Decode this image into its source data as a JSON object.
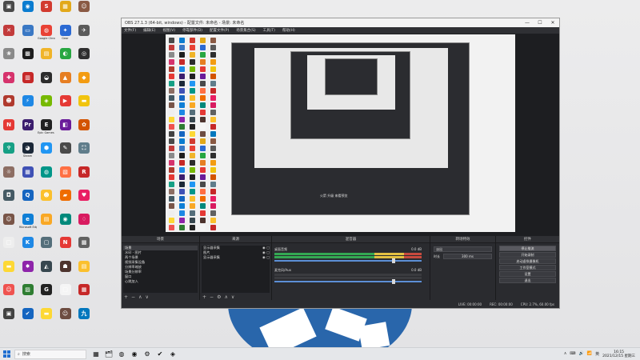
{
  "desktop": {
    "icons": [
      {
        "label": "",
        "color": "#4a4a4a",
        "glyph": "▣"
      },
      {
        "label": "",
        "color": "#0a7cd0",
        "glyph": "◉"
      },
      {
        "label": "",
        "color": "#d23b2f",
        "glyph": "S"
      },
      {
        "label": "",
        "color": "#e2a81a",
        "glyph": "▦"
      },
      {
        "label": "",
        "color": "#8a5a44",
        "glyph": "☺"
      },
      {
        "label": "",
        "color": "#c23b3b",
        "glyph": "✕"
      },
      {
        "label": "",
        "color": "#3a78c4",
        "glyph": "▭"
      },
      {
        "label": "Google Chrome",
        "color": "#e94235",
        "glyph": "◍"
      },
      {
        "label": "Gear",
        "color": "#2b6ad3",
        "glyph": "✦"
      },
      {
        "label": "",
        "color": "#5a5a5a",
        "glyph": "✈"
      },
      {
        "label": "",
        "color": "#8a8a8a",
        "glyph": "❀"
      },
      {
        "label": "",
        "color": "#1d1d1d",
        "glyph": "▩"
      },
      {
        "label": "",
        "color": "#f0b429",
        "glyph": "▤"
      },
      {
        "label": "",
        "color": "#27a641",
        "glyph": "◐"
      },
      {
        "label": "",
        "color": "#2f2f2f",
        "glyph": "◎"
      },
      {
        "label": "",
        "color": "#d6336c",
        "glyph": "✚"
      },
      {
        "label": "",
        "color": "#c62828",
        "glyph": "▥"
      },
      {
        "label": "",
        "color": "#2c2c2c",
        "glyph": "◒"
      },
      {
        "label": "",
        "color": "#e67e22",
        "glyph": "▲"
      },
      {
        "label": "",
        "color": "#f39c12",
        "glyph": "◆"
      },
      {
        "label": "",
        "color": "#b03a2e",
        "glyph": "☻"
      },
      {
        "label": "",
        "color": "#1e88e5",
        "glyph": "⚡"
      },
      {
        "label": "",
        "color": "#76b900",
        "glyph": "◈"
      },
      {
        "label": "",
        "color": "#e53935",
        "glyph": "▶"
      },
      {
        "label": "",
        "color": "#f1c40f",
        "glyph": "▬"
      },
      {
        "label": "",
        "color": "#e53935",
        "glyph": "N"
      },
      {
        "label": "",
        "color": "#3c1e6e",
        "glyph": "Pr"
      },
      {
        "label": "Epic Games Launcher",
        "color": "#222",
        "glyph": "E"
      },
      {
        "label": "",
        "color": "#6a1b9a",
        "glyph": "◧"
      },
      {
        "label": "",
        "color": "#d35400",
        "glyph": "✿"
      },
      {
        "label": "",
        "color": "#16a085",
        "glyph": "♆"
      },
      {
        "label": "Steam",
        "color": "#1b2838",
        "glyph": "◕"
      },
      {
        "label": "",
        "color": "#2196f3",
        "glyph": "⬢"
      },
      {
        "label": "",
        "color": "#4a4a4a",
        "glyph": "✎"
      },
      {
        "label": "",
        "color": "#607d8b",
        "glyph": "⛶"
      },
      {
        "label": "",
        "color": "#8d6e63",
        "glyph": "☼"
      },
      {
        "label": "",
        "color": "#3f51b5",
        "glyph": "▦"
      },
      {
        "label": "",
        "color": "#009688",
        "glyph": "◍"
      },
      {
        "label": "",
        "color": "#ff7043",
        "glyph": "▧"
      },
      {
        "label": "",
        "color": "#c62828",
        "glyph": "R"
      },
      {
        "label": "",
        "color": "#455a64",
        "glyph": "◘"
      },
      {
        "label": "",
        "color": "#1565c0",
        "glyph": "Q"
      },
      {
        "label": "",
        "color": "#fbc02d",
        "glyph": "☻"
      },
      {
        "label": "",
        "color": "#ef6c00",
        "glyph": "▰"
      },
      {
        "label": "",
        "color": "#e91e63",
        "glyph": "♥"
      },
      {
        "label": "",
        "color": "#795548",
        "glyph": "☺"
      },
      {
        "label": "Microsoft Edge",
        "color": "#0f7fd6",
        "glyph": "e"
      },
      {
        "label": "",
        "color": "#f9a825",
        "glyph": "▤"
      },
      {
        "label": "",
        "color": "#00897b",
        "glyph": "◉"
      },
      {
        "label": "",
        "color": "#d81b60",
        "glyph": "♢"
      },
      {
        "label": "",
        "color": "#eeeeee",
        "glyph": "□"
      },
      {
        "label": "",
        "color": "#1e88e5",
        "glyph": "K"
      },
      {
        "label": "",
        "color": "#546e7a",
        "glyph": "▢"
      },
      {
        "label": "",
        "color": "#e53935",
        "glyph": "N"
      },
      {
        "label": "",
        "color": "#616161",
        "glyph": "▩"
      },
      {
        "label": "",
        "color": "#fdd835",
        "glyph": "▬"
      },
      {
        "label": "",
        "color": "#8e24aa",
        "glyph": "✸"
      },
      {
        "label": "",
        "color": "#37474f",
        "glyph": "◭"
      },
      {
        "label": "",
        "color": "#4e342e",
        "glyph": "☗"
      },
      {
        "label": "",
        "color": "#fbc02d",
        "glyph": "▤"
      },
      {
        "label": "",
        "color": "#ef5350",
        "glyph": "☺"
      },
      {
        "label": "",
        "color": "#2e7d32",
        "glyph": "▨"
      },
      {
        "label": "",
        "color": "#222",
        "glyph": "G"
      },
      {
        "label": "",
        "color": "#f5f5f5",
        "glyph": "□"
      },
      {
        "label": "",
        "color": "#c62828",
        "glyph": "▦"
      },
      {
        "label": "",
        "color": "#424242",
        "glyph": "▣"
      },
      {
        "label": "",
        "color": "#1565c0",
        "glyph": "✔"
      },
      {
        "label": "",
        "color": "#fdd835",
        "glyph": "▬"
      },
      {
        "label": "",
        "color": "#6d4c41",
        "glyph": "☺"
      },
      {
        "label": "",
        "color": "#0277bd",
        "glyph": "九"
      }
    ]
  },
  "obs": {
    "title": "OBS 27.1.3 (64-bit, windows) - 配置文件: 未命名 - 场景: 未命名",
    "menu": [
      "文件(F)",
      "编辑(E)",
      "视图(V)",
      "停靠部件(D)",
      "配置文件(P)",
      "场景集合(S)",
      "工具(T)",
      "帮助(H)"
    ],
    "docks": {
      "scenes_title": "场景",
      "sources_title": "来源",
      "mixer_title": "混音器",
      "transitions_title": "转场特效",
      "controls_title": "控件"
    },
    "scenes": [
      "场景",
      "水印 - 图片",
      "两个场景",
      "视频采集设备",
      "分辨率缩放",
      "场景分辨率",
      "窗口",
      "心跳加入"
    ],
    "sources": [
      "显示器采集",
      "图片",
      "显示器采集"
    ],
    "mixer": [
      {
        "name": "桌面音频",
        "level": "0.0 dB"
      },
      {
        "name": "麦克风/Aux",
        "level": "0.0 dB"
      }
    ],
    "transitions": {
      "type": "淡出",
      "duration_label": "时长",
      "duration": "300 ms"
    },
    "controls": [
      "停止推流",
      "开始录制",
      "启动虚拟摄像机",
      "工作室模式",
      "设置",
      "退出"
    ],
    "status": [
      "LIVE: 00:00:00",
      "REC: 00:00:00",
      "CPU: 2.7%, 60.00 fps"
    ],
    "nested_banner": "火箭 升级 来看预览",
    "footer_icons": [
      "+",
      "−",
      "⚙",
      "∧",
      "∨"
    ]
  },
  "taskbar": {
    "search_placeholder": "搜索",
    "apps": [
      "▦",
      "🗂",
      "◍",
      "◉",
      "⚙",
      "✔",
      "◈"
    ],
    "tray": [
      "∧",
      "⌨",
      "🔊",
      "📶",
      "英"
    ],
    "time": "16:15",
    "date": "2021/12/15 星期三"
  }
}
